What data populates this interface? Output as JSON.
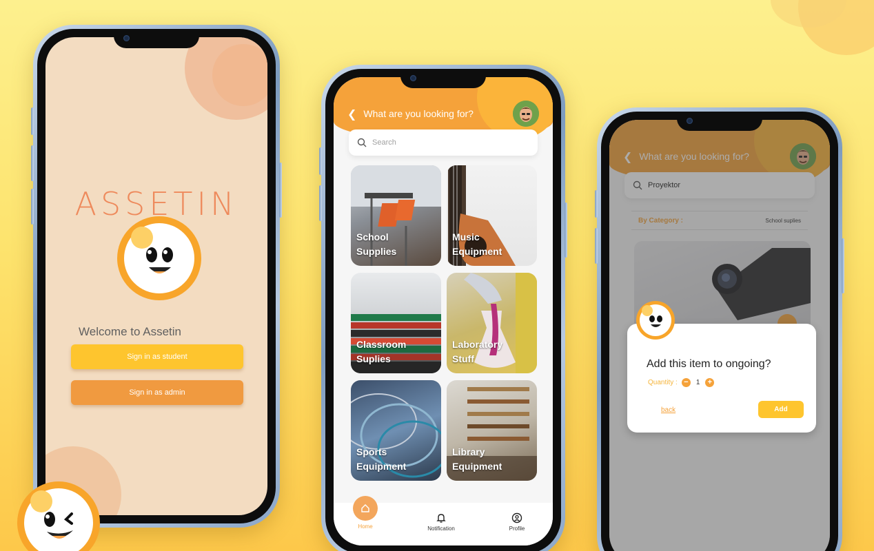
{
  "phone1": {
    "logo_text": "ASSETIN",
    "welcome": "Welcome to Assetin",
    "student_button": "Sign in as student",
    "admin_button": "Sign in as admin"
  },
  "phone2": {
    "header_title": "What are you looking for?",
    "search_placeholder": "Search",
    "categories": [
      {
        "label": "School Supplies"
      },
      {
        "label": "Music Equipment"
      },
      {
        "label": "Classroom Suplies"
      },
      {
        "label": "Laboratory Stuff"
      },
      {
        "label": "Sports Equipment"
      },
      {
        "label": "Library Equipment"
      }
    ],
    "nav": {
      "home": "Home",
      "notification": "Notification",
      "profile": "Profile"
    }
  },
  "phone3": {
    "header_title": "What are you looking for?",
    "search_value": "Proyektor",
    "category_label": "By Category :",
    "category_value": "School suplies",
    "modal": {
      "title": "Add this item to ongoing?",
      "quantity_label": "Quantity :",
      "quantity_value": "1",
      "back_label": "back",
      "add_label": "Add"
    }
  },
  "colors": {
    "orange": "#f5a23a",
    "yellow": "#fec52e",
    "peach": "#f3dcc1"
  }
}
